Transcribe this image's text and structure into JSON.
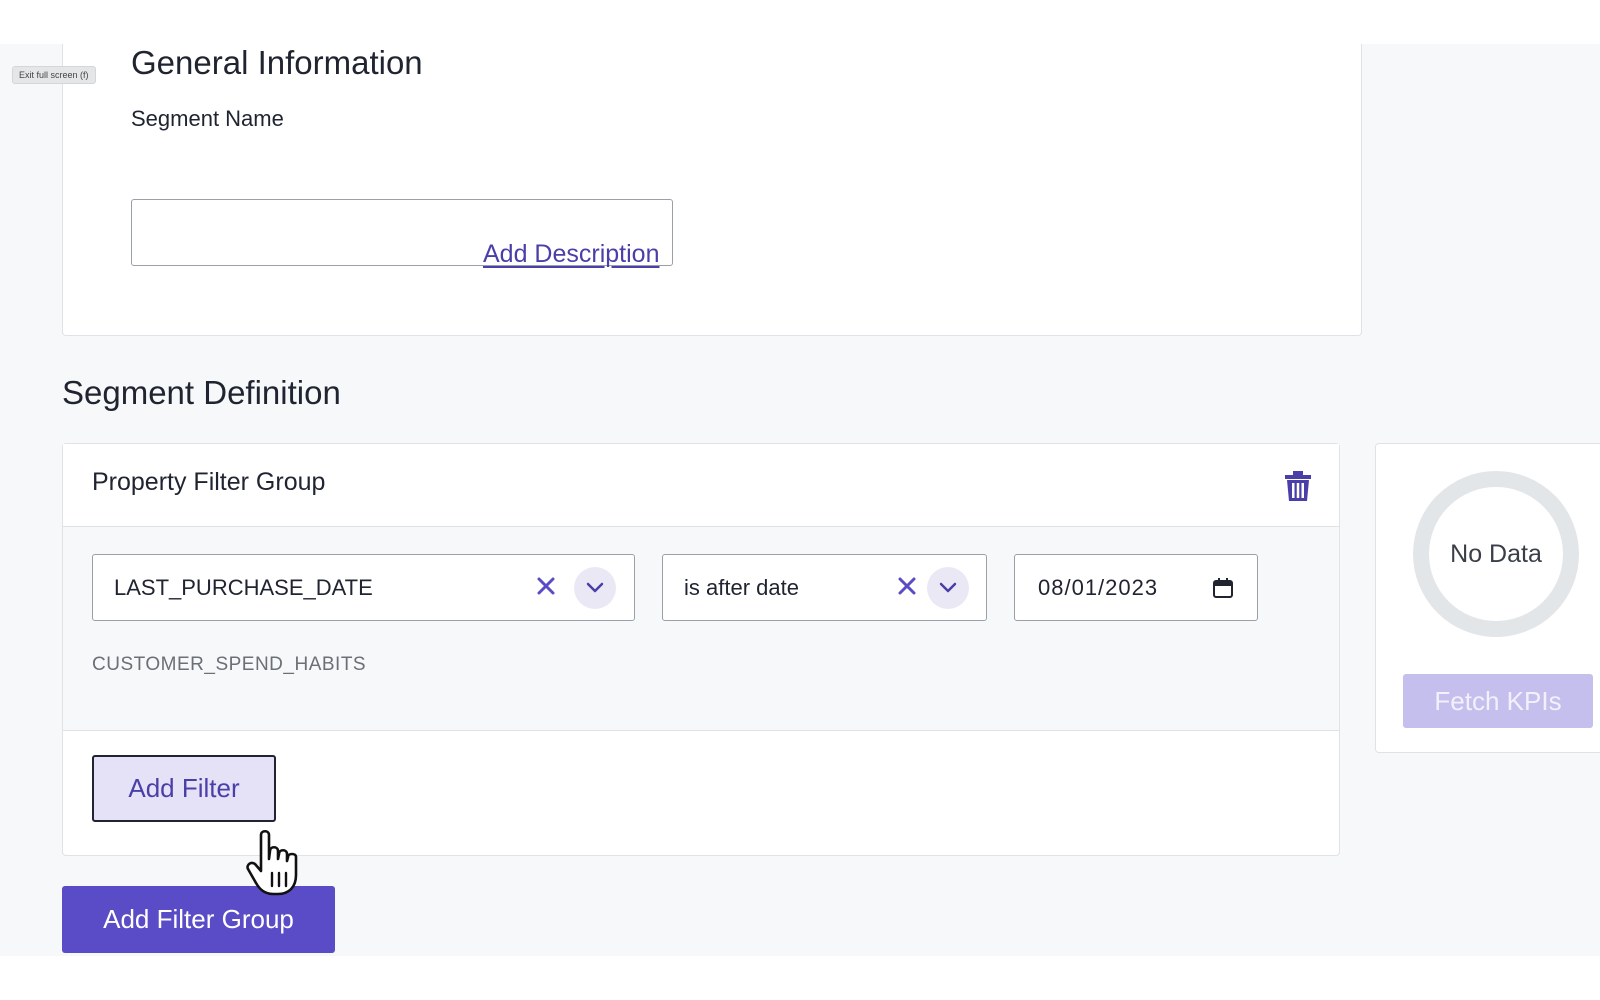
{
  "system": {
    "exit_fullscreen_tooltip": "Exit full screen (f)"
  },
  "general_information": {
    "title": "General Information",
    "segment_name_label": "Segment Name",
    "segment_name_value": "",
    "add_description_link": "Add Description"
  },
  "segment_definition": {
    "title": "Segment Definition",
    "filter_group": {
      "title": "Property Filter Group",
      "delete_icon": "trash-icon",
      "filter": {
        "property": "LAST_PURCHASE_DATE",
        "operator": "is after date",
        "date_value": "08/01/2023",
        "table": "CUSTOMER_SPEND_HABITS"
      },
      "add_filter_label": "Add Filter"
    },
    "add_filter_group_label": "Add Filter Group"
  },
  "kpi_panel": {
    "donut_label": "No Data",
    "fetch_button_label": "Fetch KPIs"
  },
  "colors": {
    "accent": "#5a4bc6",
    "accent_light": "#e5e1f6",
    "link": "#4a3fa8",
    "disabled_button": "#c5bfee"
  }
}
